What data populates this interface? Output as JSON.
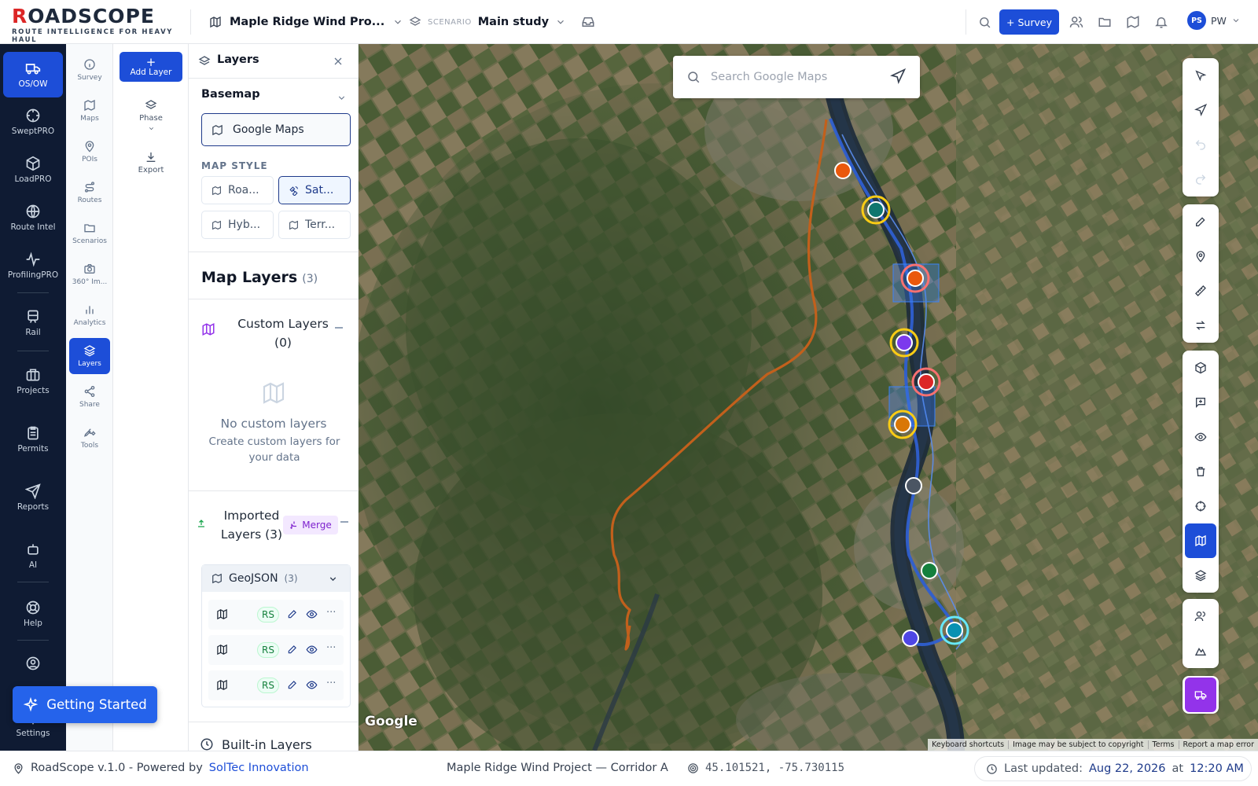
{
  "app": {
    "logo_road": "R",
    "logo_o": "O",
    "logo_rest": "ADSCOPE",
    "tagline": "ROUTE INTELLIGENCE FOR HEAVY HAUL"
  },
  "header": {
    "project_title": "Maple Ridge Wind Pro...",
    "scenario_caption": "SCENARIO",
    "scenario_value": "Main study",
    "survey_label": "Survey",
    "avatar_initials": "PS",
    "user_label": "PW"
  },
  "rail": {
    "items": [
      {
        "label": "OS/OW",
        "icon": "truck-icon"
      },
      {
        "label": "SweptPRO",
        "icon": "target-icon"
      },
      {
        "label": "LoadPRO",
        "icon": "cube-icon"
      },
      {
        "label": "Route Intel",
        "icon": "globe-icon"
      },
      {
        "label": "ProfilingPRO",
        "icon": "pulse-icon"
      },
      {
        "label": "Rail",
        "icon": "train-icon"
      },
      {
        "label": "Projects",
        "icon": "briefcase-icon"
      },
      {
        "label": "Permits",
        "icon": "clipboard-icon"
      },
      {
        "label": "Reports",
        "icon": "send-icon"
      },
      {
        "label": "AI",
        "icon": "robot-icon"
      },
      {
        "label": "Help",
        "icon": "lifebuoy-icon"
      },
      {
        "label": "Settings",
        "icon": "gear-icon"
      }
    ]
  },
  "tools": {
    "items": [
      {
        "label": "Survey"
      },
      {
        "label": "Maps"
      },
      {
        "label": "POIs"
      },
      {
        "label": "Routes"
      },
      {
        "label": "Scenarios"
      },
      {
        "label": "360° Im..."
      },
      {
        "label": "Analytics"
      },
      {
        "label": "Layers"
      },
      {
        "label": "Share"
      },
      {
        "label": "Tools"
      }
    ]
  },
  "actions": {
    "add_layer": "Add Layer",
    "phase": "Phase",
    "export": "Export"
  },
  "panel": {
    "title": "Layers",
    "basemap_heading": "Basemap",
    "basemap_selected": "Google Maps",
    "map_style_label": "MAP STYLE",
    "styles": [
      "Roa...",
      "Sat...",
      "Hyb...",
      "Terr..."
    ],
    "map_layers_title": "Map Layers",
    "map_layers_count": "(3)",
    "custom_layers_title": "Custom Layers (0)",
    "empty_title": "No custom layers",
    "empty_sub": "Create custom layers for your data",
    "imported_title": "Imported Layers (3)",
    "merge_label": "Merge",
    "geojson_label": "GeoJSON",
    "geojson_count": "(3)",
    "geo_rows": [
      {
        "badge": "RS"
      },
      {
        "badge": "RS"
      },
      {
        "badge": "RS"
      }
    ],
    "builtin_title": "Built-in Layers"
  },
  "map": {
    "search_placeholder": "Search Google Maps",
    "google_logo": "Google",
    "attribution": [
      "Keyboard shortcuts",
      "Image may be subject to copyright",
      "Terms",
      "Report a map error"
    ]
  },
  "getting_started": "Getting Started",
  "footer": {
    "version": "RoadScope v.1.0 - Powered by",
    "company": "SolTec Innovation",
    "project": "Maple Ridge Wind Project — Corridor A",
    "coords": "45.101521,  -75.730115",
    "updated_label": "Last updated:",
    "updated_date": "Aug 22, 2026",
    "updated_at": "at",
    "updated_time": "12:20 AM"
  },
  "colors": {
    "accent": "#1d4ed8",
    "rail_bg": "#0f1b33",
    "route_orange": "#c2601c",
    "route_blue": "#2f5fd0"
  }
}
